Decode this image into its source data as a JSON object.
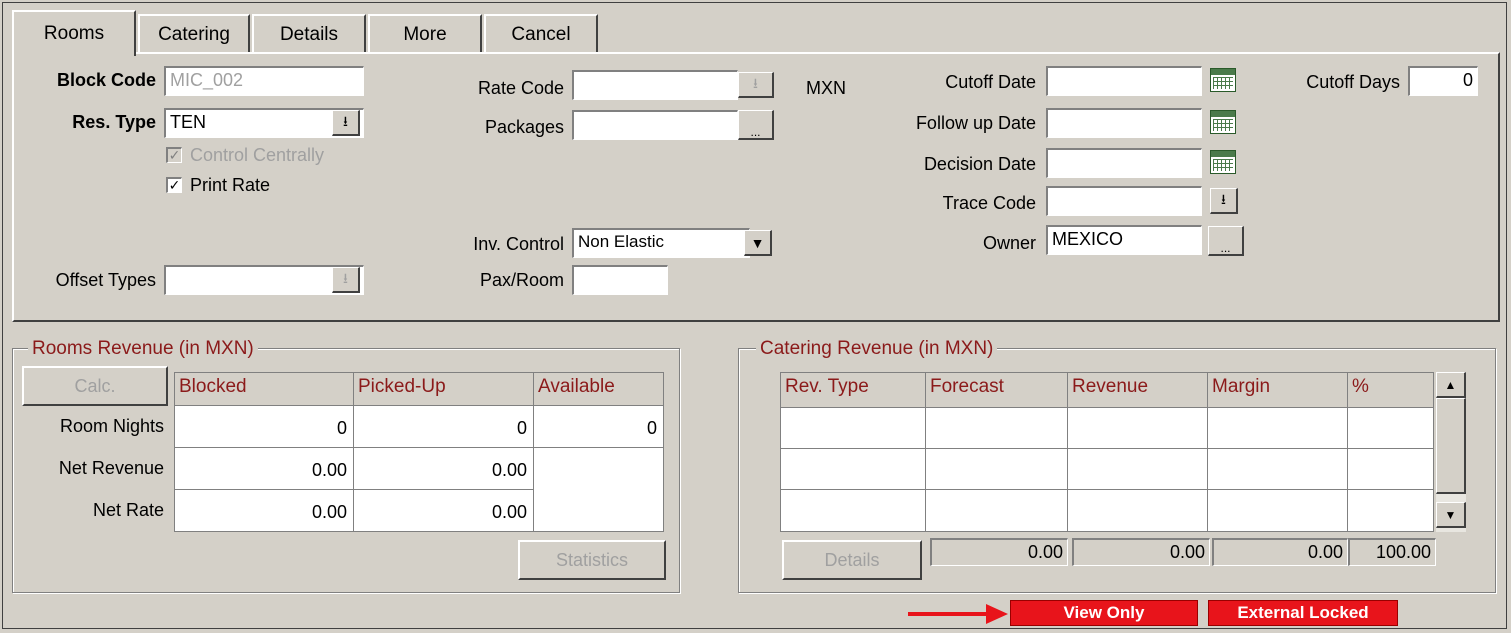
{
  "tabs": [
    "Rooms",
    "Catering",
    "Details",
    "More",
    "Cancel"
  ],
  "block": {
    "block_code_label": "Block Code",
    "block_code_value": "MIC_002",
    "res_type_label": "Res. Type",
    "res_type_value": "TEN",
    "control_centrally_label": "Control Centrally",
    "control_centrally_checked": true,
    "print_rate_label": "Print Rate",
    "print_rate_checked": true,
    "offset_types_label": "Offset Types",
    "offset_types_value": "",
    "rate_code_label": "Rate Code",
    "rate_code_value": "",
    "packages_label": "Packages",
    "packages_value": "",
    "currency": "MXN",
    "inv_control_label": "Inv. Control",
    "inv_control_value": "Non Elastic",
    "pax_room_label": "Pax/Room",
    "pax_room_value": "",
    "cutoff_date_label": "Cutoff Date",
    "follow_up_date_label": "Follow up Date",
    "decision_date_label": "Decision Date",
    "trace_code_label": "Trace Code",
    "owner_label": "Owner",
    "owner_value": "MEXICO",
    "cutoff_days_label": "Cutoff Days",
    "cutoff_days_value": "0"
  },
  "rooms_revenue": {
    "title": "Rooms Revenue (in  MXN)",
    "calc_label": "Calc.",
    "columns": [
      "Blocked",
      "Picked-Up",
      "Available"
    ],
    "rows": [
      {
        "label": "Room Nights",
        "values": [
          "0",
          "0",
          "0"
        ]
      },
      {
        "label": "Net Revenue",
        "values": [
          "0.00",
          "0.00",
          ""
        ]
      },
      {
        "label": "Net Rate",
        "values": [
          "0.00",
          "0.00",
          ""
        ]
      }
    ],
    "statistics_label": "Statistics"
  },
  "catering_revenue": {
    "title": "Catering Revenue (in  MXN)",
    "columns": [
      "Rev. Type",
      "Forecast",
      "Revenue",
      "Margin",
      "%"
    ],
    "details_label": "Details",
    "totals": [
      "0.00",
      "0.00",
      "0.00",
      "100.00"
    ]
  },
  "status": {
    "view_only": "View Only",
    "external_locked": "External Locked"
  },
  "colors": {
    "background": "#d4d0c8",
    "header_text": "#8b1a1a",
    "status_red": "#e8141b"
  }
}
